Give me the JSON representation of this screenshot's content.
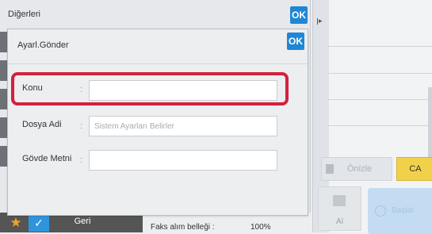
{
  "outer_dialog": {
    "title": "Diğerleri",
    "ok_label": "OK"
  },
  "inner_dialog": {
    "title": "Ayarl.Gönder",
    "ok_label": "OK",
    "fields": [
      {
        "label": "Konu",
        "colon": ":",
        "value": "",
        "placeholder": ""
      },
      {
        "label": "Dosya Adi",
        "colon": ":",
        "value": "",
        "placeholder": "Sistem Ayarları Belirler"
      },
      {
        "label": "Gövde Metni",
        "colon": ":",
        "value": "",
        "placeholder": ""
      }
    ]
  },
  "background": {
    "preview_label": "Önizle",
    "ca_label": "CA",
    "receive_label": "Al",
    "start_label": "Başlat"
  },
  "bottom_bar": {
    "back_label": "Geri",
    "status_label": "Faks alım belleği :",
    "status_value": "100%"
  },
  "colors": {
    "accent": "#1e87d6",
    "highlight": "#d3213c",
    "ca": "#f2d14a"
  },
  "icons": [
    "star-icon",
    "check-icon",
    "play-icon",
    "preview-icon",
    "receive-icon",
    "start-icon"
  ]
}
